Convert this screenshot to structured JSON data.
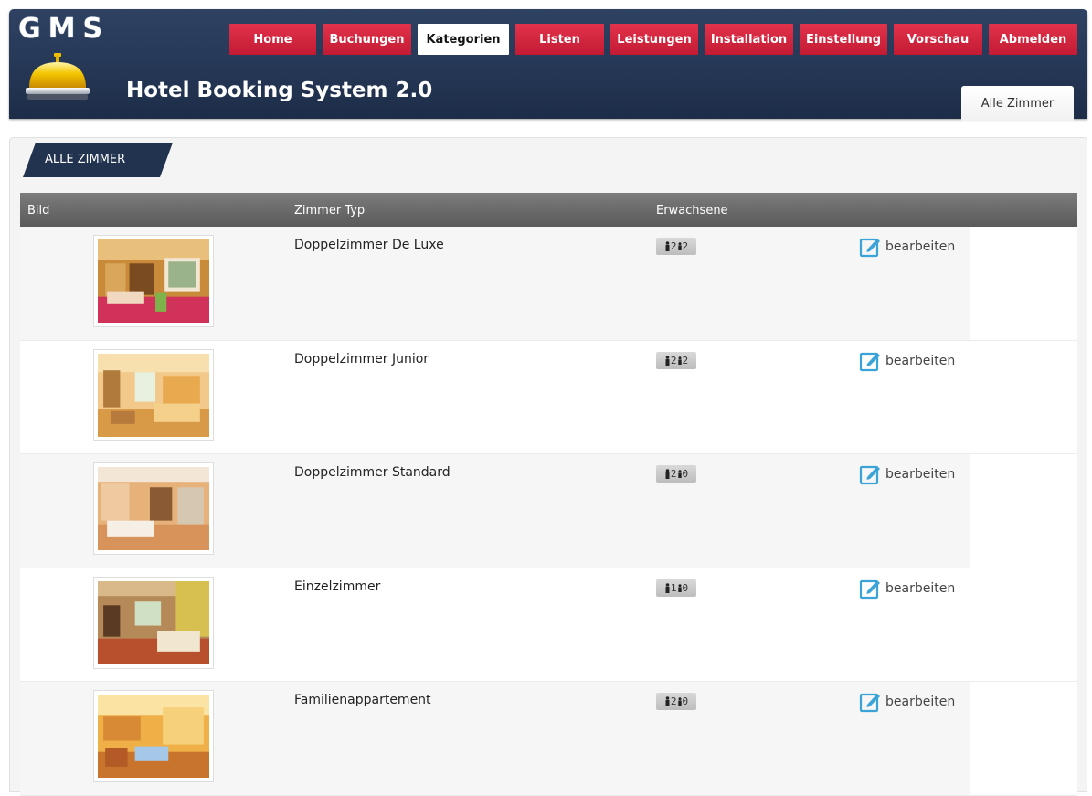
{
  "header": {
    "logo_text": "GMS",
    "app_title": "Hotel Booking System 2.0",
    "nav": [
      {
        "label": "Home",
        "active": false
      },
      {
        "label": "Buchungen",
        "active": false
      },
      {
        "label": "Kategorien",
        "active": true
      },
      {
        "label": "Listen",
        "active": false
      },
      {
        "label": "Leistungen",
        "active": false
      },
      {
        "label": "Installation",
        "active": false
      },
      {
        "label": "Einstellung",
        "active": false
      },
      {
        "label": "Vorschau",
        "active": false
      },
      {
        "label": "Abmelden",
        "active": false
      }
    ],
    "tab_label": "Alle Zimmer"
  },
  "section": {
    "title": "ALLE ZIMMER"
  },
  "table": {
    "columns": {
      "image": "Bild",
      "type": "Zimmer Typ",
      "adults": "Erwachsene"
    },
    "rows": [
      {
        "name": "Doppelzimmer De Luxe",
        "adults": "2",
        "children": "2",
        "edit": "bearbeiten"
      },
      {
        "name": "Doppelzimmer Junior",
        "adults": "2",
        "children": "2",
        "edit": "bearbeiten"
      },
      {
        "name": "Doppelzimmer Standard",
        "adults": "2",
        "children": "0",
        "edit": "bearbeiten"
      },
      {
        "name": "Einzelzimmer",
        "adults": "1",
        "children": "0",
        "edit": "bearbeiten"
      },
      {
        "name": "Familienappartement",
        "adults": "2",
        "children": "0",
        "edit": "bearbeiten"
      }
    ]
  },
  "colors": {
    "header_bg": "#243654",
    "nav_red": "#d1223c",
    "accent_edit": "#3aa3d8"
  },
  "icons": {
    "bell": "hotel-bell-icon",
    "edit": "edit-icon",
    "person": "person-icon"
  }
}
